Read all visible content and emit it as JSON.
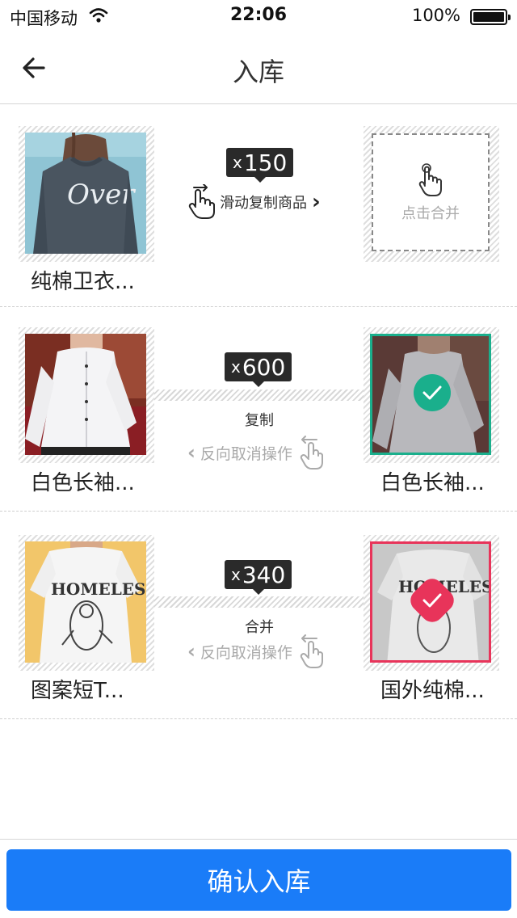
{
  "status_bar": {
    "carrier": "中国移动",
    "time": "22:06",
    "battery": "100%"
  },
  "nav": {
    "title": "入库",
    "back_icon": "arrow-left-icon"
  },
  "rows": [
    {
      "source_name": "纯棉卫衣...",
      "quantity_prefix": "x",
      "quantity": "150",
      "hint": "滑动复制商品",
      "target_placeholder": "点击合并"
    },
    {
      "source_name": "白色长袖...",
      "quantity_prefix": "x",
      "quantity": "600",
      "action": "复制",
      "undo": "反向取消操作",
      "target_name": "白色长袖...",
      "target_status_color": "#1aaf8c"
    },
    {
      "source_name": "图案短T...",
      "quantity_prefix": "x",
      "quantity": "340",
      "action": "合并",
      "undo": "反向取消操作",
      "target_name": "国外纯棉...",
      "target_status_color": "#e8345a"
    }
  ],
  "footer": {
    "confirm_label": "确认入库",
    "accent_color": "#1a7cf8"
  }
}
